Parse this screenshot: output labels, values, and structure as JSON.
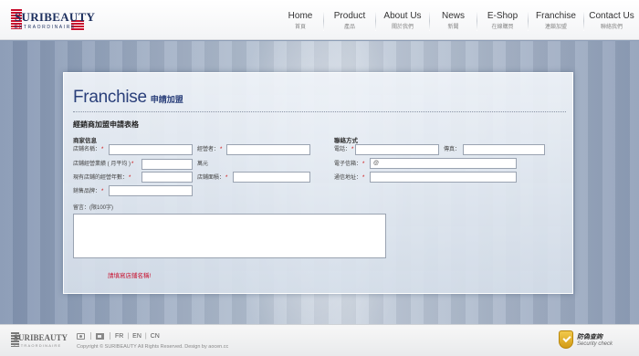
{
  "header": {
    "logo_word": "SURIBEAUTY",
    "logo_sub": "EXTRAORDINAIRE",
    "nav": [
      {
        "en": "Home",
        "zh": "首頁"
      },
      {
        "en": "Product",
        "zh": "產品"
      },
      {
        "en": "About Us",
        "zh": "關於我們"
      },
      {
        "en": "News",
        "zh": "新聞"
      },
      {
        "en": "E-Shop",
        "zh": "在線購買"
      },
      {
        "en": "Franchise",
        "zh": "連鎖加盟"
      },
      {
        "en": "Contact Us",
        "zh": "聯絡我們"
      }
    ]
  },
  "panel": {
    "title_en": "Franchise",
    "title_zh": "申請加盟",
    "form_title": "經銷商加盟申請表格",
    "left_section": "商家信息",
    "right_section": "聯絡方式",
    "required_mark": "*",
    "fields": {
      "store_name": "店鋪名稱：",
      "operator": "經營者：",
      "monthly_revenue": "店鋪經營業績 ( 月平均 )",
      "unit": "萬元",
      "years": "現有店鋪的經營年數：",
      "area": "店鋪面積：",
      "brands": "銷售品牌：",
      "phone": "電話：",
      "fax": "傳真：",
      "email": "電子信箱：",
      "email_value": "@",
      "address": "通信地址：",
      "message": "留言：(限100字)"
    },
    "error": "請填寫店鋪名稱!"
  },
  "footer": {
    "logo_word": "SURIBEAUTY",
    "logo_sub": "EXTRAORDINAIRE",
    "langs": [
      "FR",
      "EN",
      "CN"
    ],
    "lang_divider": "|",
    "copyright": "Copyright © SURIBEAUTY All Rights Reserved. Design by aocen.cc",
    "security_zh": "防偽查詢",
    "security_en": "Security check"
  }
}
